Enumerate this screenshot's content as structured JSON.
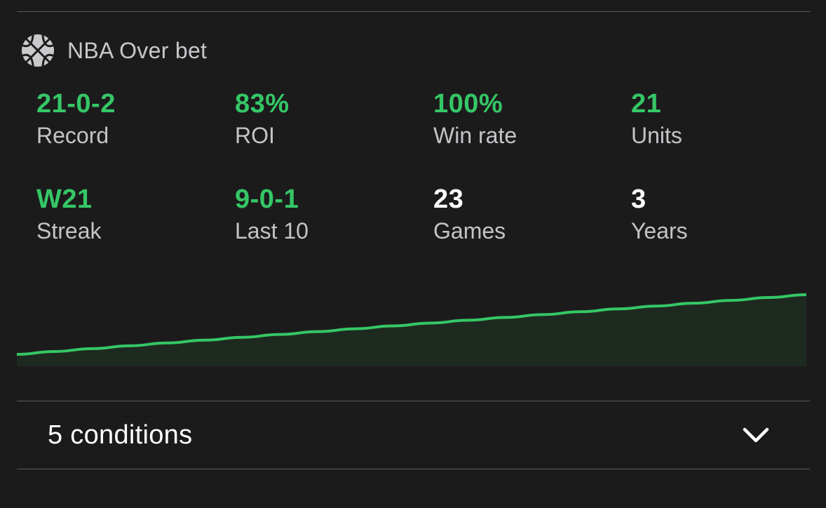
{
  "header": {
    "icon": "basketball-icon",
    "title": "NBA Over bet"
  },
  "stats": {
    "record": {
      "value": "21-0-2",
      "label": "Record"
    },
    "roi": {
      "value": "83%",
      "label": "ROI"
    },
    "win_rate": {
      "value": "100%",
      "label": "Win rate"
    },
    "units": {
      "value": "21",
      "label": "Units"
    },
    "streak": {
      "value": "W21",
      "label": "Streak"
    },
    "last10": {
      "value": "9-0-1",
      "label": "Last 10"
    },
    "games": {
      "value": "23",
      "label": "Games"
    },
    "years": {
      "value": "3",
      "label": "Years"
    }
  },
  "colors": {
    "background": "#1c1b1c",
    "accent_green": "#35c766",
    "area_fill": "#1e2a20",
    "divider": "#5a5a5c"
  },
  "chart_data": {
    "type": "area",
    "y": [
      0,
      1,
      2,
      3,
      4,
      5,
      6,
      7,
      8,
      9,
      10,
      11,
      12,
      13,
      14,
      15,
      16,
      17,
      18,
      19,
      20,
      21
    ],
    "title": "",
    "xlabel": "",
    "ylabel": "",
    "grid": false
  },
  "footer": {
    "conditions_label": "5 conditions",
    "expand_icon": "chevron-down-icon"
  }
}
